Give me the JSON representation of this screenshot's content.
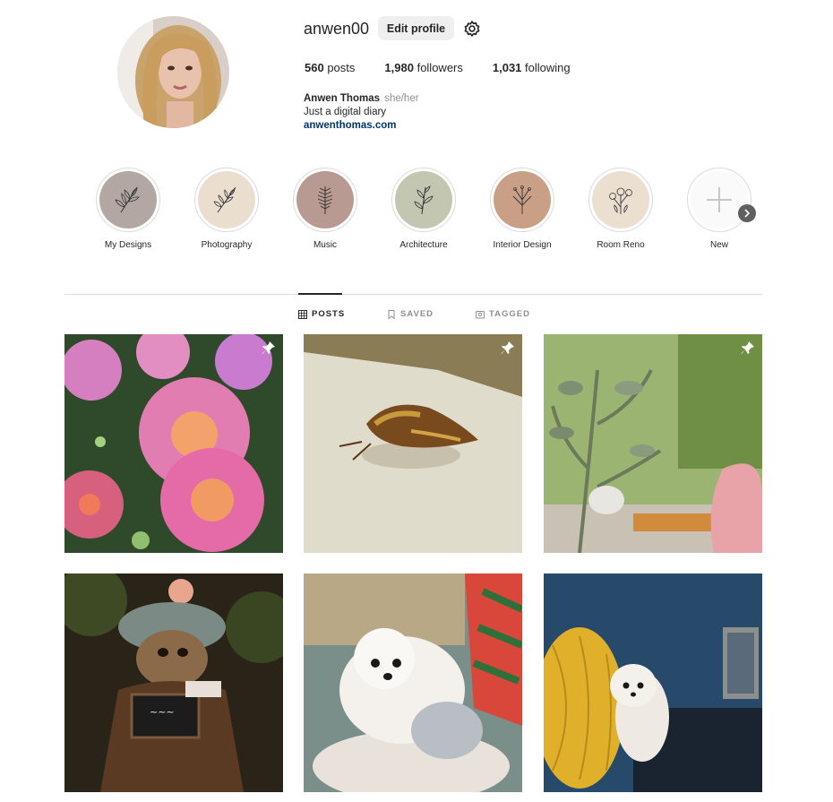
{
  "profile": {
    "username": "anwen00",
    "edit_label": "Edit profile",
    "settings_icon": "gear-icon"
  },
  "stats": {
    "posts_count": "560",
    "posts_label": "posts",
    "followers_count": "1,980",
    "followers_label": "followers",
    "following_count": "1,031",
    "following_label": "following"
  },
  "bio": {
    "name": "Anwen Thomas",
    "pronouns": "she/her",
    "text": "Just a digital diary",
    "link": "anwenthomas.com"
  },
  "highlights": [
    {
      "label": "My Designs",
      "color": "#b3a7a3"
    },
    {
      "label": "Photography",
      "color": "#eadfcf"
    },
    {
      "label": "Music",
      "color": "#b99a92"
    },
    {
      "label": "Architecture",
      "color": "#c3c6b1"
    },
    {
      "label": "Interior Design",
      "color": "#c99f86"
    },
    {
      "label": "Room Reno",
      "color": "#ebdfd0"
    },
    {
      "label": "New",
      "color": "#ffffff"
    }
  ],
  "tabs": [
    {
      "label": "POSTS",
      "icon": "grid-icon",
      "active": true
    },
    {
      "label": "SAVED",
      "icon": "bookmark-icon",
      "active": false
    },
    {
      "label": "TAGGED",
      "icon": "tag-icon",
      "active": false
    }
  ],
  "posts": [
    {
      "subject": "pink-chrysanthemums",
      "pinned": true
    },
    {
      "subject": "dried-wasp",
      "pinned": true
    },
    {
      "subject": "fuzzy-plant",
      "pinned": true
    },
    {
      "subject": "frog-figurine",
      "pinned": false
    },
    {
      "subject": "white-dog-with-toy",
      "pinned": false
    },
    {
      "subject": "white-dog-on-chair",
      "pinned": false
    }
  ]
}
